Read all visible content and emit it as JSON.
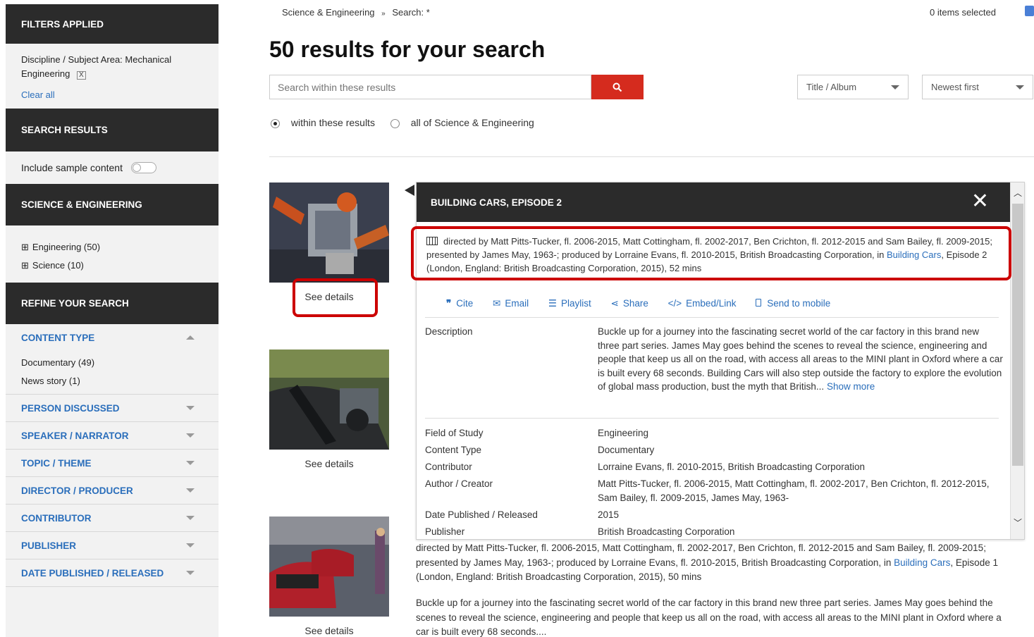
{
  "sidebar": {
    "filters_title": "FILTERS APPLIED",
    "filter_text": "Discipline / Subject Area: Mechanical Engineering",
    "filter_remove": "X",
    "clear_all": "Clear all",
    "search_results_title": "SEARCH RESULTS",
    "include_sample": "Include sample content",
    "section_title": "SCIENCE & ENGINEERING",
    "tree": [
      {
        "expander": "⊞",
        "label": "Engineering (50)"
      },
      {
        "expander": "⊞",
        "label": "Science (10)"
      }
    ],
    "refine_title": "REFINE YOUR SEARCH",
    "content_type": {
      "label": "CONTENT TYPE",
      "options": [
        "Documentary (49)",
        "News story (1)"
      ]
    },
    "facets": [
      "PERSON DISCUSSED",
      "SPEAKER / NARRATOR",
      "TOPIC / THEME",
      "DIRECTOR / PRODUCER",
      "CONTRIBUTOR",
      "PUBLISHER",
      "DATE PUBLISHED / RELEASED"
    ]
  },
  "header": {
    "breadcrumb_1": "Science & Engineering",
    "breadcrumb_sep": "»",
    "breadcrumb_2": "Search: *",
    "items_selected": "0 items selected"
  },
  "main": {
    "heading": "50 results for your search",
    "search_placeholder": "Search within these results",
    "sort_field": "Title / Album",
    "sort_order": "Newest first",
    "radio_within": "within these results",
    "radio_all": "all of Science & Engineering"
  },
  "results": [
    {
      "see_details": "See details"
    },
    {
      "see_details": "See details"
    },
    {
      "see_details": "See details"
    }
  ],
  "popup": {
    "title": "BUILDING CARS, EPISODE 2",
    "citation_pre": "directed by Matt Pitts-Tucker, fl. 2006-2015, Matt Cottingham, fl. 2002-2017, Ben Crichton, fl. 2012-2015 and Sam Bailey, fl. 2009-2015; presented by James May, 1963-; produced by Lorraine Evans, fl. 2010-2015, British Broadcasting Corporation, in ",
    "citation_link": "Building Cars",
    "citation_post": ", Episode 2 (London, England: British Broadcasting Corporation, 2015), 52 mins",
    "actions": {
      "cite": "Cite",
      "email": "Email",
      "playlist": "Playlist",
      "share": "Share",
      "embed": "Embed/Link",
      "mobile": "Send to mobile"
    },
    "description_label": "Description",
    "description": "Buckle up for a journey into the fascinating secret world of the car factory in this brand new three part series. James May goes behind the scenes to reveal the science, engineering and people that keep us all on the road, with access all areas to the MINI plant in Oxford where a car is built every 68 seconds. Building Cars will also step outside the factory to explore the evolution of global mass production, bust the myth that British...",
    "show_more": "Show more",
    "fields": [
      {
        "label": "Field of Study",
        "value": "Engineering"
      },
      {
        "label": "Content Type",
        "value": "Documentary"
      },
      {
        "label": "Contributor",
        "value": "Lorraine Evans, fl. 2010-2015, British Broadcasting Corporation"
      },
      {
        "label": "Author / Creator",
        "value": "Matt Pitts-Tucker, fl. 2006-2015, Matt Cottingham, fl. 2002-2017, Ben Crichton, fl. 2012-2015, Sam Bailey, fl. 2009-2015, James May, 1963-"
      },
      {
        "label": "Date Published / Released",
        "value": "2015"
      },
      {
        "label": "Publisher",
        "value": "British Broadcasting Corporation"
      }
    ]
  },
  "result3": {
    "citation_pre": "directed by Matt Pitts-Tucker, fl. 2006-2015, Matt Cottingham, fl. 2002-2017, Ben Crichton, fl. 2012-2015 and Sam Bailey, fl. 2009-2015; presented by James May, 1963-; produced by Lorraine Evans, fl. 2010-2015, British Broadcasting Corporation, in ",
    "citation_link": "Building Cars",
    "citation_post": ", Episode 1 (London, England: British Broadcasting Corporation, 2015), 50 mins",
    "description": "Buckle up for a journey into the fascinating secret world of the car factory in this brand new three part series. James May goes behind the scenes to reveal the science, engineering and people that keep us all on the road, with access all areas to the MINI plant in Oxford where a car is built every 68 seconds...."
  },
  "colors": {
    "accent_red": "#d52b1e",
    "link_blue": "#2a6ebb",
    "dark_header": "#2b2b2b",
    "highlight_red": "#cc0000"
  }
}
